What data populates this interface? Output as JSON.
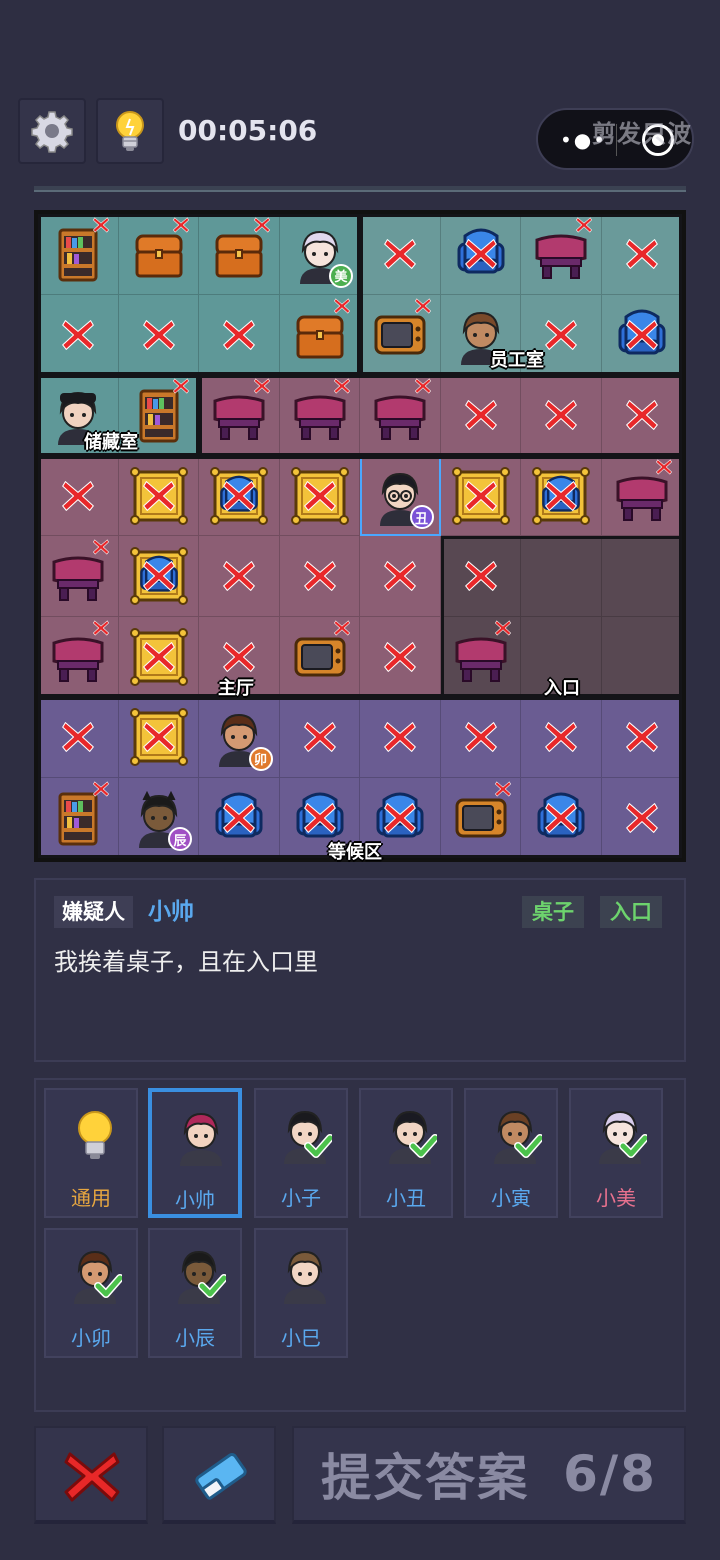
{
  "header": {
    "timer": "00:05:06",
    "settings_icon": "gear-icon",
    "hint_icon": "lightbulb-icon",
    "watermark": "剪发只波"
  },
  "board": {
    "rooms": [
      {
        "name": "储藏室"
      },
      {
        "name": "员工室"
      },
      {
        "name": "主厅"
      },
      {
        "name": "入口"
      },
      {
        "name": "等候区"
      }
    ],
    "badges": [
      {
        "text": "美",
        "color": "#4caf50"
      },
      {
        "text": "丑",
        "color": "#7a52d6"
      },
      {
        "text": "卯",
        "color": "#e07a2e"
      },
      {
        "text": "辰",
        "color": "#a04fc4"
      }
    ],
    "colors": {
      "teal": "#5f9898",
      "mauve": "#8c5e74",
      "entrance": "#584852",
      "purple": "#6a5c92",
      "cross": "#e8282a"
    }
  },
  "clue": {
    "label": "嫌疑人",
    "suspect": "小帅",
    "tags": [
      "桌子",
      "入口"
    ],
    "text": "我挨着桌子，且在入口里"
  },
  "suspects": [
    {
      "label": "通用",
      "color": "#e6a640",
      "icon": "lightbulb-icon",
      "checked": false,
      "selected": false
    },
    {
      "label": "小帅",
      "color": "#5aa8ee",
      "icon": "avatar-xiaoshuai",
      "checked": false,
      "selected": true
    },
    {
      "label": "小子",
      "color": "#5aa8ee",
      "icon": "avatar-xiaozi",
      "checked": true,
      "selected": false
    },
    {
      "label": "小丑",
      "color": "#5aa8ee",
      "icon": "avatar-xiaochou",
      "checked": true,
      "selected": false
    },
    {
      "label": "小寅",
      "color": "#5aa8ee",
      "icon": "avatar-xiaoyin",
      "checked": true,
      "selected": false
    },
    {
      "label": "小美",
      "color": "#e8718e",
      "icon": "avatar-xiaomei",
      "checked": true,
      "selected": false
    },
    {
      "label": "小卯",
      "color": "#5aa8ee",
      "icon": "avatar-xiaomao",
      "checked": true,
      "selected": false
    },
    {
      "label": "小辰",
      "color": "#5aa8ee",
      "icon": "avatar-xiaochen",
      "checked": true,
      "selected": false
    },
    {
      "label": "小巳",
      "color": "#5aa8ee",
      "icon": "avatar-xiaosi",
      "checked": false,
      "selected": false
    }
  ],
  "footer": {
    "clear_icon": "red-x-icon",
    "eraser_icon": "eraser-icon",
    "submit_label": "提交答案",
    "progress": "6/8"
  }
}
